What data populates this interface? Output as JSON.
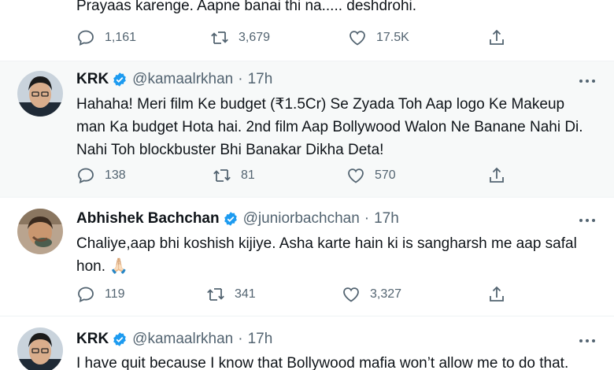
{
  "colors": {
    "verified": "#1d9bf0",
    "text": "#0f1419",
    "muted": "#536471",
    "divider": "#eff3f4"
  },
  "tweets": [
    {
      "text": "Prayaas karenge. Aapne banai thi na..... deshdrohi.",
      "replies": "1,161",
      "retweets": "3,679",
      "likes": "17.5K"
    },
    {
      "name": "KRK",
      "handle": "@kamaalrkhan",
      "dot": "·",
      "time": "17h",
      "text": "Hahaha! Meri film Ke budget (₹1.5Cr) Se Zyada Toh Aap logo Ke Makeup man Ka budget Hota hai. 2nd film Aap Bollywood Walon Ne Banane Nahi Di. Nahi Toh blockbuster Bhi Banakar Dikha Deta!",
      "replies": "138",
      "retweets": "81",
      "likes": "570"
    },
    {
      "name": "Abhishek Bachchan",
      "handle": "@juniorbachchan",
      "dot": "·",
      "time": "17h",
      "text": "Chaliye,aap bhi koshish kijiye. Asha karte hain ki is sangharsh me aap safal hon. 🙏🏻",
      "replies": "119",
      "retweets": "341",
      "likes": "3,327"
    },
    {
      "name": "KRK",
      "handle": "@kamaalrkhan",
      "dot": "·",
      "time": "17h",
      "text": "I have quit because I know that Bollywood mafia won’t allow me to do that."
    }
  ]
}
